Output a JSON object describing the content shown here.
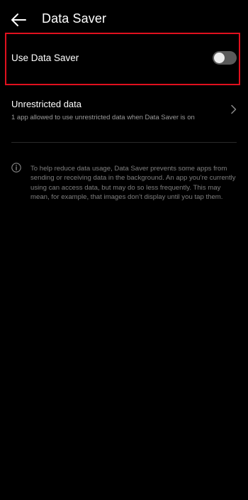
{
  "header": {
    "title": "Data Saver",
    "back_icon": "arrow-left-icon"
  },
  "data_saver": {
    "label": "Use Data Saver",
    "toggle_state": "off"
  },
  "unrestricted": {
    "title": "Unrestricted data",
    "subtitle": "1 app allowed to use unrestricted data when Data Saver is on",
    "chevron_icon": "chevron-right-icon"
  },
  "info": {
    "icon": "info-icon",
    "text": "To help reduce data usage, Data Saver prevents some apps from sending or receiving data in the background. An app you’re currently using can access data, but may do so less frequently. This may mean, for example, that images don’t display until you tap them."
  },
  "colors": {
    "background": "#000000",
    "highlight_border": "#e0101e",
    "toggle_track_off": "#5a5a5a",
    "toggle_knob": "#ececec",
    "secondary_text": "#9b9b9b"
  }
}
